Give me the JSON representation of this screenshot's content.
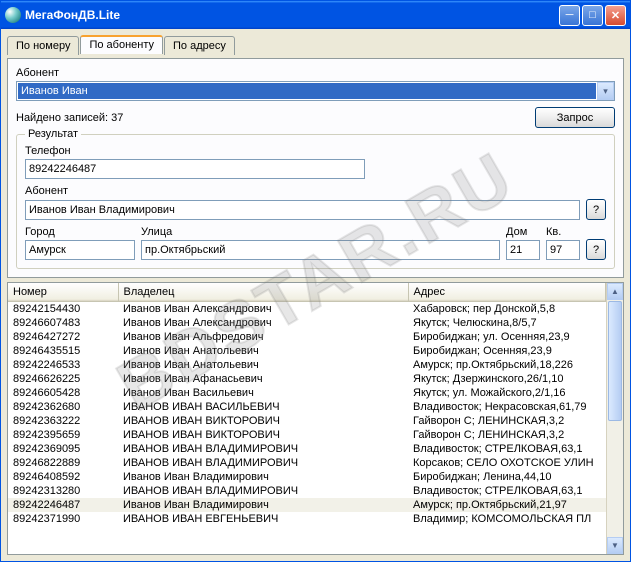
{
  "window": {
    "title": "МегаФонДВ.Lite"
  },
  "tabs": {
    "by_number": "По номеру",
    "by_subscriber": "По абоненту",
    "by_address": "По адресу"
  },
  "search": {
    "label": "Абонент",
    "value": "Иванов Иван",
    "found_label": "Найдено записей: 37",
    "query_button": "Запрос"
  },
  "result": {
    "legend": "Результат",
    "phone_label": "Телефон",
    "phone_value": "89242246487",
    "subscriber_label": "Абонент",
    "subscriber_value": "Иванов Иван Владимирович",
    "city_label": "Город",
    "city_value": "Амурск",
    "street_label": "Улица",
    "street_value": "пр.Октябрьский",
    "house_label": "Дом",
    "house_value": "21",
    "apt_label": "Кв.",
    "apt_value": "97",
    "help": "?"
  },
  "grid": {
    "headers": {
      "number": "Номер",
      "owner": "Владелец",
      "address": "Адрес"
    },
    "rows": [
      {
        "n": "89242154430",
        "o": "Иванов Иван Александрович",
        "a": "Хабаровск; пер Донской,5,8"
      },
      {
        "n": "89246607483",
        "o": "Иванов Иван Александрович",
        "a": "Якутск; Челюскина,8/5,7"
      },
      {
        "n": "89246427272",
        "o": "Иванов Иван Альфредович",
        "a": "Биробиджан; ул. Осенняя,23,9"
      },
      {
        "n": "89246435515",
        "o": "Иванов Иван Анатольевич",
        "a": "Биробиджан; Осенняя,23,9"
      },
      {
        "n": "89242246533",
        "o": "Иванов Иван Анатольевич",
        "a": "Амурск; пр.Октябрьский,18,226"
      },
      {
        "n": "89246626225",
        "o": "Иванов Иван Афанасьевич",
        "a": "Якутск; Дзержинского,26/1,10"
      },
      {
        "n": "89246605428",
        "o": "Иванов Иван Васильевич",
        "a": "Якутск; ул. Можайского,2/1,16"
      },
      {
        "n": "89242362680",
        "o": "ИВАНОВ ИВАН ВАСИЛЬЕВИЧ",
        "a": "Владивосток; Некрасовская,61,79"
      },
      {
        "n": "89242363222",
        "o": "ИВАНОВ ИВАН ВИКТОРОВИЧ",
        "a": "Гайворон С; ЛЕНИНСКАЯ,3,2"
      },
      {
        "n": "89242395659",
        "o": "ИВАНОВ ИВАН ВИКТОРОВИЧ",
        "a": "Гайворон С; ЛЕНИНСКАЯ,3,2"
      },
      {
        "n": "89242369095",
        "o": "ИВАНОВ ИВАН ВЛАДИМИРОВИЧ",
        "a": "Владивосток; СТРЕЛКОВАЯ,63,1"
      },
      {
        "n": "89246822889",
        "o": "ИВАНОВ ИВАН ВЛАДИМИРОВИЧ",
        "a": "Корсаков; СЕЛО ОХОТСКОЕ УЛИН"
      },
      {
        "n": "89246408592",
        "o": "Иванов Иван Владимирович",
        "a": "Биробиджан; Ленина,44,10"
      },
      {
        "n": "89242313280",
        "o": "ИВАНОВ ИВАН ВЛАДИМИРОВИЧ",
        "a": "Владивосток; СТРЕЛКОВАЯ,63,1"
      },
      {
        "n": "89242246487",
        "o": "Иванов Иван Владимирович",
        "a": "Амурск; пр.Октябрьский,21,97",
        "hilite": true
      },
      {
        "n": "89242371990",
        "o": "ИВАНОВ ИВАН ЕВГЕНЬЕВИЧ",
        "a": "Владимир; КОМСОМОЛЬСКАЯ ПЛ"
      }
    ]
  },
  "watermark": "BDSTAR.RU"
}
